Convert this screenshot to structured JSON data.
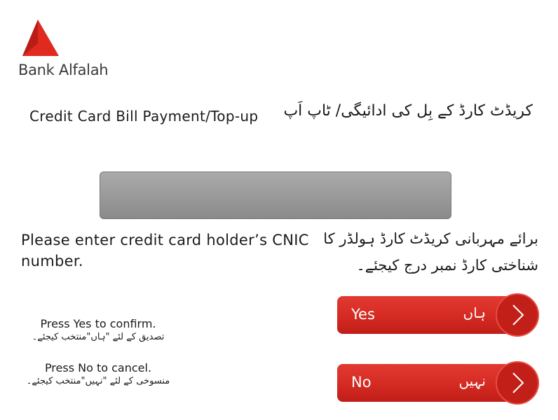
{
  "brand": {
    "name": "Bank Alfalah",
    "logo_icon": "alfalah-triangle-logo",
    "logo_color": "#e0291f"
  },
  "screen": {
    "title_en": "Credit Card Bill Payment/Top-up",
    "title_ur": "کریڈٹ کارڈ کے بِل کی ادائیگی/ ٹاپ اَپ"
  },
  "input": {
    "value": ""
  },
  "prompt": {
    "en": "Please enter credit card holder’s CNIC number.",
    "ur": "برائے مہربانی کریڈٹ کارڈ ہولڈر کا شناختی کارڈ نمبر درج کیجئے۔"
  },
  "hints": {
    "yes_en": "Press Yes to confirm.",
    "yes_ur": "تصدیق کے لئے \"ہاں\"منتخب کیجئے۔",
    "no_en": "Press No to cancel.",
    "no_ur": "منسوخی کے لئے \"نہیں\"منتخب کیجئے۔"
  },
  "buttons": {
    "yes": {
      "label_en": "Yes",
      "label_ur": "ہاں",
      "icon": "chevron-right-icon"
    },
    "no": {
      "label_en": "No",
      "label_ur": "نہیں",
      "icon": "chevron-right-icon"
    },
    "color": "#d42a22"
  }
}
